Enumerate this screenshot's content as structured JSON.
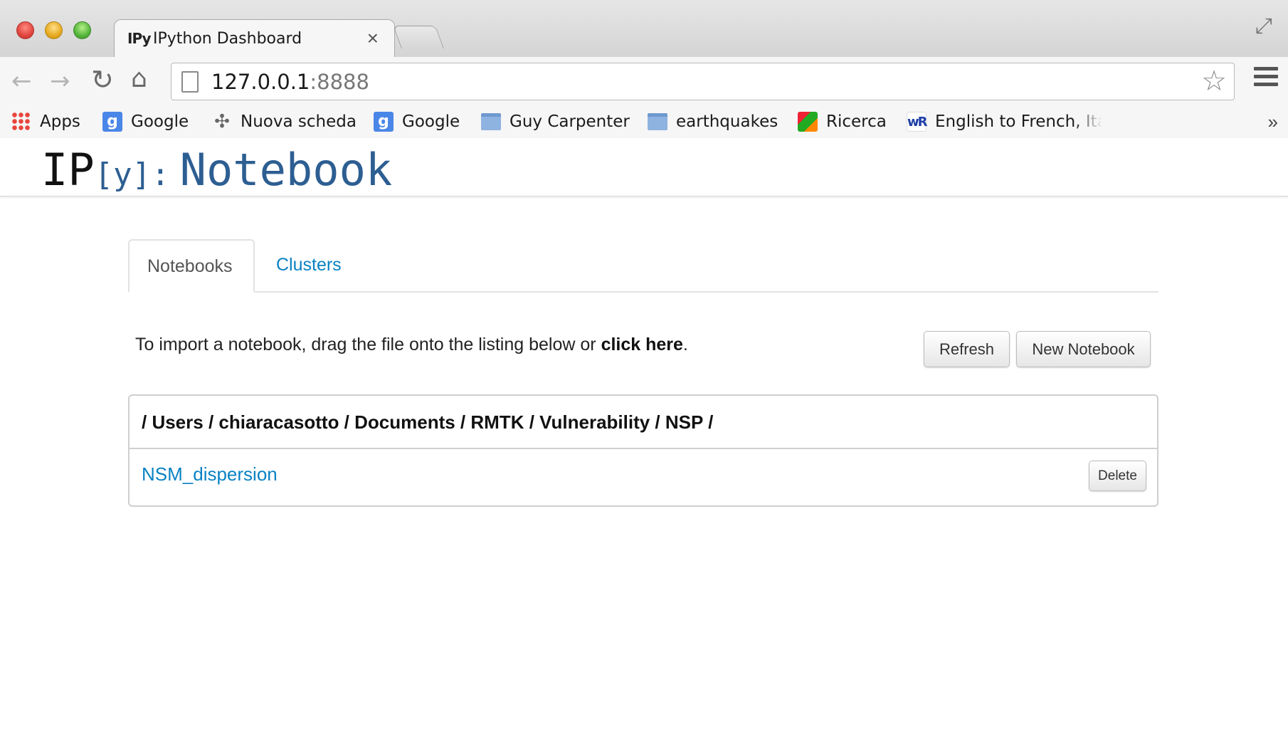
{
  "browser": {
    "tab": {
      "favicon_text": "IPy",
      "title": "IPython Dashboard",
      "close": "×"
    },
    "address": {
      "host": "127.0.0.1",
      "port": ":8888"
    },
    "bookmarks": [
      {
        "label": "Apps",
        "icon": "apps-grid-icon"
      },
      {
        "label": "Google",
        "icon": "google-icon"
      },
      {
        "label": "Nuova scheda",
        "icon": "puzzle-icon"
      },
      {
        "label": "Google",
        "icon": "google-icon"
      },
      {
        "label": "Guy Carpenter",
        "icon": "folder-icon"
      },
      {
        "label": "earthquakes",
        "icon": "folder-icon"
      },
      {
        "label": "Ricerca",
        "icon": "ricerca-icon"
      },
      {
        "label": "English to French, Ita",
        "icon": "wordreference-icon"
      }
    ],
    "bookmarks_overflow": "»"
  },
  "app": {
    "logo": {
      "ip": "IP",
      "y": "[y]:",
      "notebook": "Notebook"
    },
    "tabs": [
      {
        "label": "Notebooks",
        "active": true
      },
      {
        "label": "Clusters",
        "active": false
      }
    ],
    "import": {
      "prefix": "To import a notebook, drag the file onto the listing below or ",
      "link": "click here",
      "suffix": "."
    },
    "buttons": {
      "refresh": "Refresh",
      "new_notebook": "New Notebook"
    },
    "listing": {
      "path": "/ Users / chiaracasotto / Documents / RMTK / Vulnerability / NSP /",
      "items": [
        {
          "name": "NSM_dispersion",
          "delete_label": "Delete"
        }
      ]
    }
  },
  "colors": {
    "link": "#0a82c4",
    "logo_blue": "#2d5e92"
  }
}
